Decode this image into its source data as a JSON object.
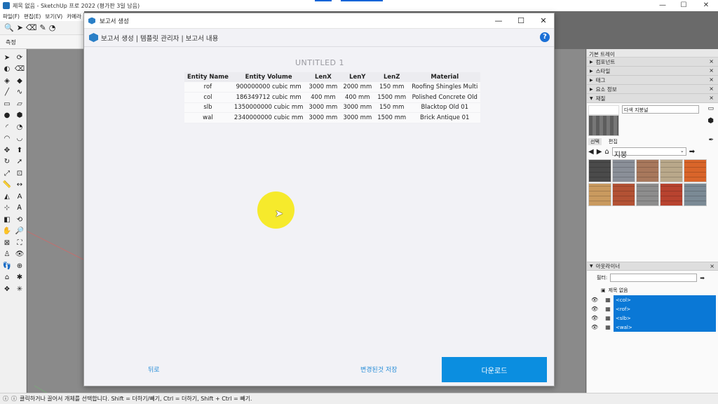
{
  "app": {
    "title": "제목 없음 - SketchUp 프로 2022 (평가판 3일 남음)",
    "menu": [
      "파일(F)",
      "편집(E)",
      "보기(V)",
      "카메라"
    ],
    "measure_label": "측정",
    "status_text": "클릭하거나 끌어서 개체를 선택합니다. Shift = 더하기/빼기, Ctrl = 더하기, Shift + Ctrl = 빼기."
  },
  "dialog": {
    "title": "보고서 생성",
    "breadcrumb": "보고서 생성 | 템플릿 관리자 | 보고서 내용",
    "report_title": "UNTITLED 1",
    "table": {
      "headers": [
        "Entity Name",
        "Entity Volume",
        "LenX",
        "LenY",
        "LenZ",
        "Material"
      ],
      "rows": [
        [
          "rof",
          "900000000 cubic mm",
          "3000 mm",
          "2000 mm",
          "150 mm",
          "Roofing Shingles Multi"
        ],
        [
          "col",
          "186349712 cubic mm",
          "400 mm",
          "400 mm",
          "1500 mm",
          "Polished Concrete Old"
        ],
        [
          "slb",
          "1350000000 cubic mm",
          "3000 mm",
          "3000 mm",
          "150 mm",
          "Blacktop Old 01"
        ],
        [
          "wal",
          "2340000000 cubic mm",
          "3000 mm",
          "3000 mm",
          "1500 mm",
          "Brick Antique 01"
        ]
      ]
    },
    "back_label": "뒤로",
    "save_label": "변경된것 저장",
    "download_label": "다운로드",
    "help_glyph": "?"
  },
  "tray": {
    "title": "기본 트레이",
    "panels": [
      "컴포넌트",
      "스타일",
      "태그",
      "요소 정보",
      "재질"
    ],
    "materials": {
      "name": "다색 지붕널",
      "tabs": [
        "선택",
        "편집"
      ],
      "category": "지붕",
      "swatch_colors": [
        "#4a4a4a",
        "#8a8f98",
        "#a8785c",
        "#b9a88a",
        "#d9652a",
        "#c99a5f",
        "#b35234",
        "#8d8d8d",
        "#b8432f",
        "#7b8a95"
      ]
    },
    "outliner": {
      "title": "아웃라이너",
      "filter_label": "필터:",
      "root": "제목 없음",
      "items": [
        "<col>",
        "<rof>",
        "<slb>",
        "<wal>"
      ]
    }
  }
}
